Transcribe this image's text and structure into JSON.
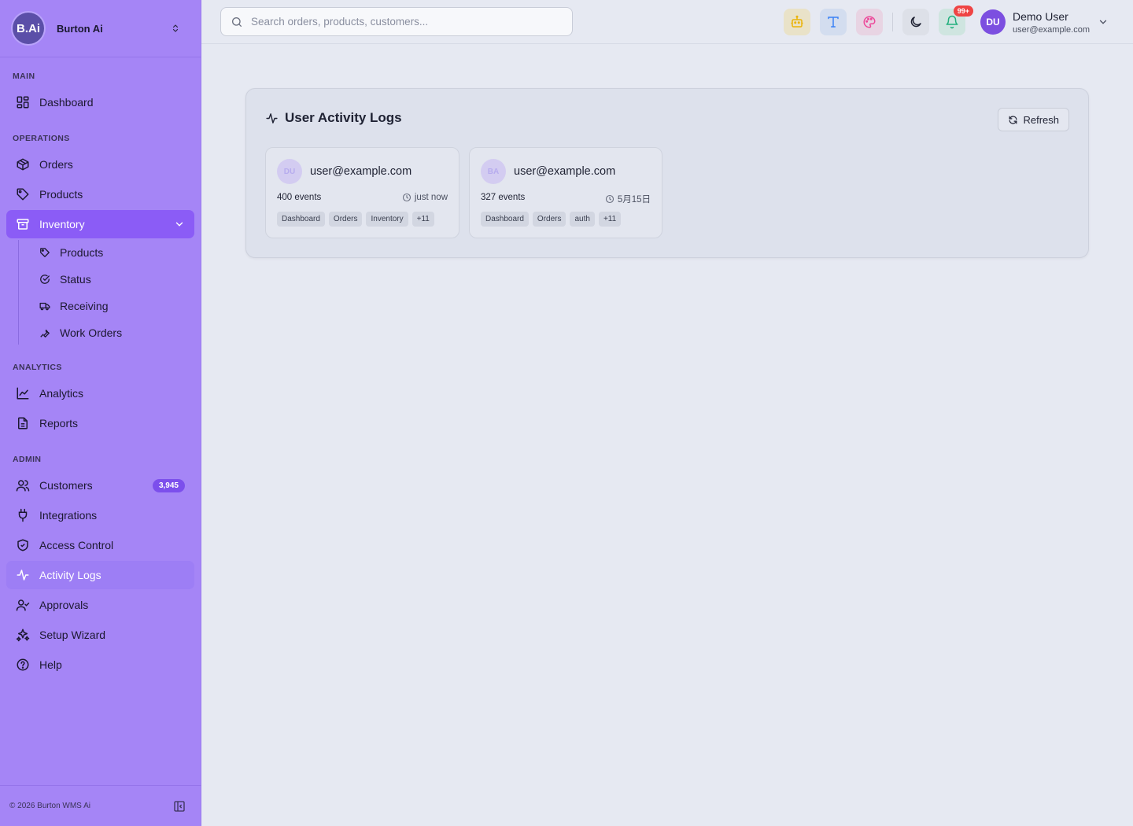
{
  "brand": {
    "logo_text": "B.Ai",
    "name": "Burton Ai"
  },
  "sidebar": {
    "sections": {
      "main": "MAIN",
      "operations": "OPERATIONS",
      "analytics": "ANALYTICS",
      "admin": "ADMIN"
    },
    "items": {
      "dashboard": "Dashboard",
      "orders": "Orders",
      "products": "Products",
      "inventory": "Inventory",
      "analytics": "Analytics",
      "reports": "Reports",
      "customers": "Customers",
      "customers_badge": "3,945",
      "integrations": "Integrations",
      "access_control": "Access Control",
      "activity_logs": "Activity Logs",
      "approvals": "Approvals",
      "setup_wizard": "Setup Wizard",
      "help": "Help"
    },
    "inventory_sub": {
      "products": "Products",
      "status": "Status",
      "receiving": "Receiving",
      "work_orders": "Work Orders"
    },
    "footer": "© 2026 Burton WMS Ai"
  },
  "topbar": {
    "search_placeholder": "Search orders, products, customers...",
    "notification_count": "99+",
    "user": {
      "initials": "DU",
      "name": "Demo User",
      "email": "user@example.com"
    }
  },
  "panel": {
    "title": "User Activity Logs",
    "refresh_label": "Refresh",
    "cards": [
      {
        "initials": "DU",
        "email": "user@example.com",
        "events": "400 events",
        "time": "just now",
        "tags": [
          "Dashboard",
          "Orders",
          "Inventory",
          "+11"
        ]
      },
      {
        "initials": "BA",
        "email": "user@example.com",
        "events": "327 events",
        "time": "5月15日",
        "tags": [
          "Dashboard",
          "Orders",
          "auth",
          "+11"
        ]
      }
    ]
  },
  "colors": {
    "sidebar_bg": "#a585f6",
    "active_parent": "#8b5cf6",
    "badge": "#7c4fec",
    "notification": "#ef4444"
  }
}
